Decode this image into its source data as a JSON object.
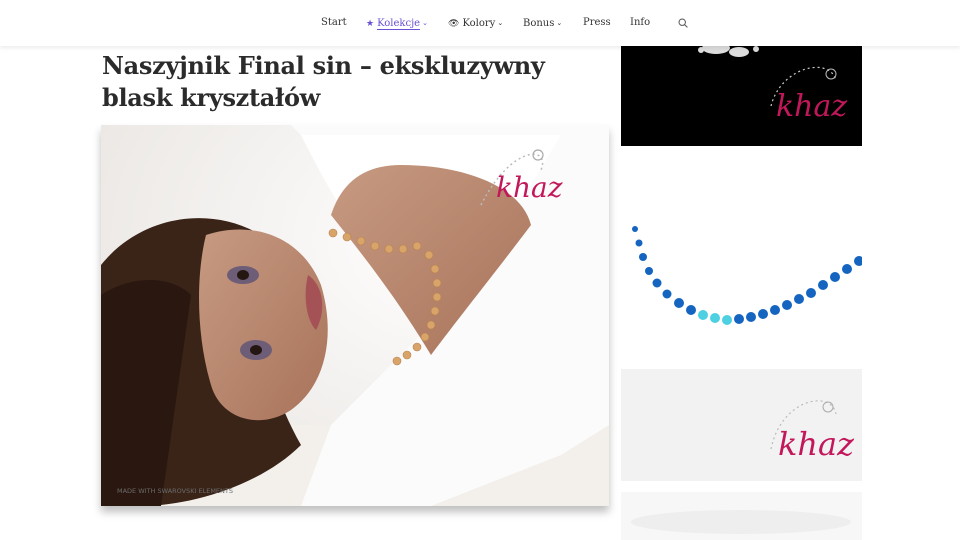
{
  "nav": {
    "items": [
      {
        "label": "Start",
        "icon": "",
        "chevron": false,
        "active": false
      },
      {
        "label": "Kolekcje",
        "icon": "star-icon",
        "chevron": true,
        "active": true
      },
      {
        "label": "Kolory",
        "icon": "eye-icon",
        "chevron": true,
        "active": false
      },
      {
        "label": "Bonus",
        "icon": "",
        "chevron": true,
        "active": false
      },
      {
        "label": "Press",
        "icon": "",
        "chevron": false,
        "active": false
      },
      {
        "label": "Info",
        "icon": "",
        "chevron": false,
        "active": false
      }
    ],
    "search_icon": "search-icon",
    "accent_color": "#6a4fd6"
  },
  "post": {
    "title": "Naszyjnik Final sin – ekskluzywny blask kryształów",
    "image_caption": "MADE WITH SWAROVSKI ELEMENTS",
    "logo": "khaz"
  },
  "sidebar": {
    "thumb1_logo": "khaz",
    "thumb2_logo": "khaz"
  },
  "colors": {
    "logo_pink": "#c2185b",
    "necklace_blue": "#1565c0",
    "necklace_teal": "#4dd0e1"
  }
}
